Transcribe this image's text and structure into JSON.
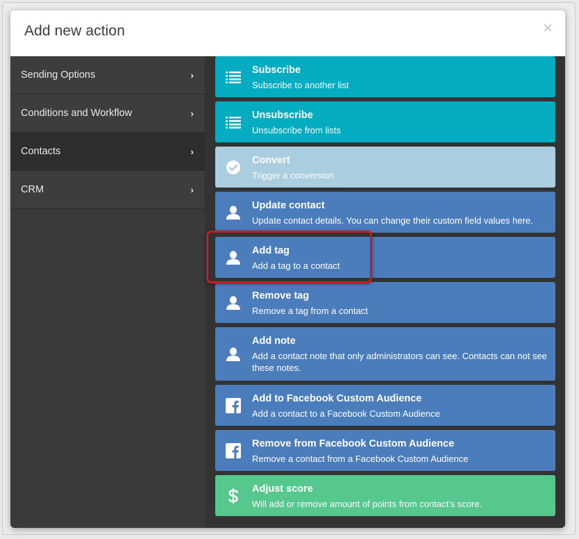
{
  "modal": {
    "title": "Add new action",
    "close_glyph": "×"
  },
  "sidebar": {
    "items": [
      {
        "label": "Sending Options",
        "chevron": "›",
        "active": false
      },
      {
        "label": "Conditions and Workflow",
        "chevron": "›",
        "active": false
      },
      {
        "label": "Contacts",
        "chevron": "›",
        "active": true
      },
      {
        "label": "CRM",
        "chevron": "›",
        "active": false
      }
    ]
  },
  "actions": [
    {
      "title": "Subscribe",
      "desc": "Subscribe to another list",
      "icon": "list-icon",
      "color": "#04acc2"
    },
    {
      "title": "Unsubscribe",
      "desc": "Unsubscribe from lists",
      "icon": "list-icon",
      "color": "#04acc2"
    },
    {
      "title": "Convert",
      "desc": "Trigger a conversion",
      "icon": "check-circle-icon",
      "color": "#abcde0"
    },
    {
      "title": "Update contact",
      "desc": "Update contact details. You can change their custom field values here.",
      "icon": "user-icon",
      "color": "#4b7dbd"
    },
    {
      "title": "Add tag",
      "desc": "Add a tag to a contact",
      "icon": "user-icon",
      "color": "#4b7dbd",
      "highlighted": true
    },
    {
      "title": "Remove tag",
      "desc": "Remove a tag from a contact",
      "icon": "user-icon",
      "color": "#4b7dbd"
    },
    {
      "title": "Add note",
      "desc": "Add a contact note that only administrators can see. Contacts can not see these notes.",
      "icon": "user-icon",
      "color": "#4b7dbd"
    },
    {
      "title": "Add to Facebook Custom Audience",
      "desc": "Add a contact to a Facebook Custom Audience",
      "icon": "facebook-icon",
      "color": "#4b7dbd"
    },
    {
      "title": "Remove from Facebook Custom Audience",
      "desc": "Remove a contact from a Facebook Custom Audience",
      "icon": "facebook-icon",
      "color": "#4b7dbd"
    },
    {
      "title": "Adjust score",
      "desc": "Will add or remove amount of points from contact's score.",
      "icon": "dollar-icon",
      "color": "#57c88d"
    }
  ],
  "colors": {
    "highlight_border": "#d0181d",
    "sidebar_bg": "#3d3d3d",
    "content_bg": "#333333"
  }
}
